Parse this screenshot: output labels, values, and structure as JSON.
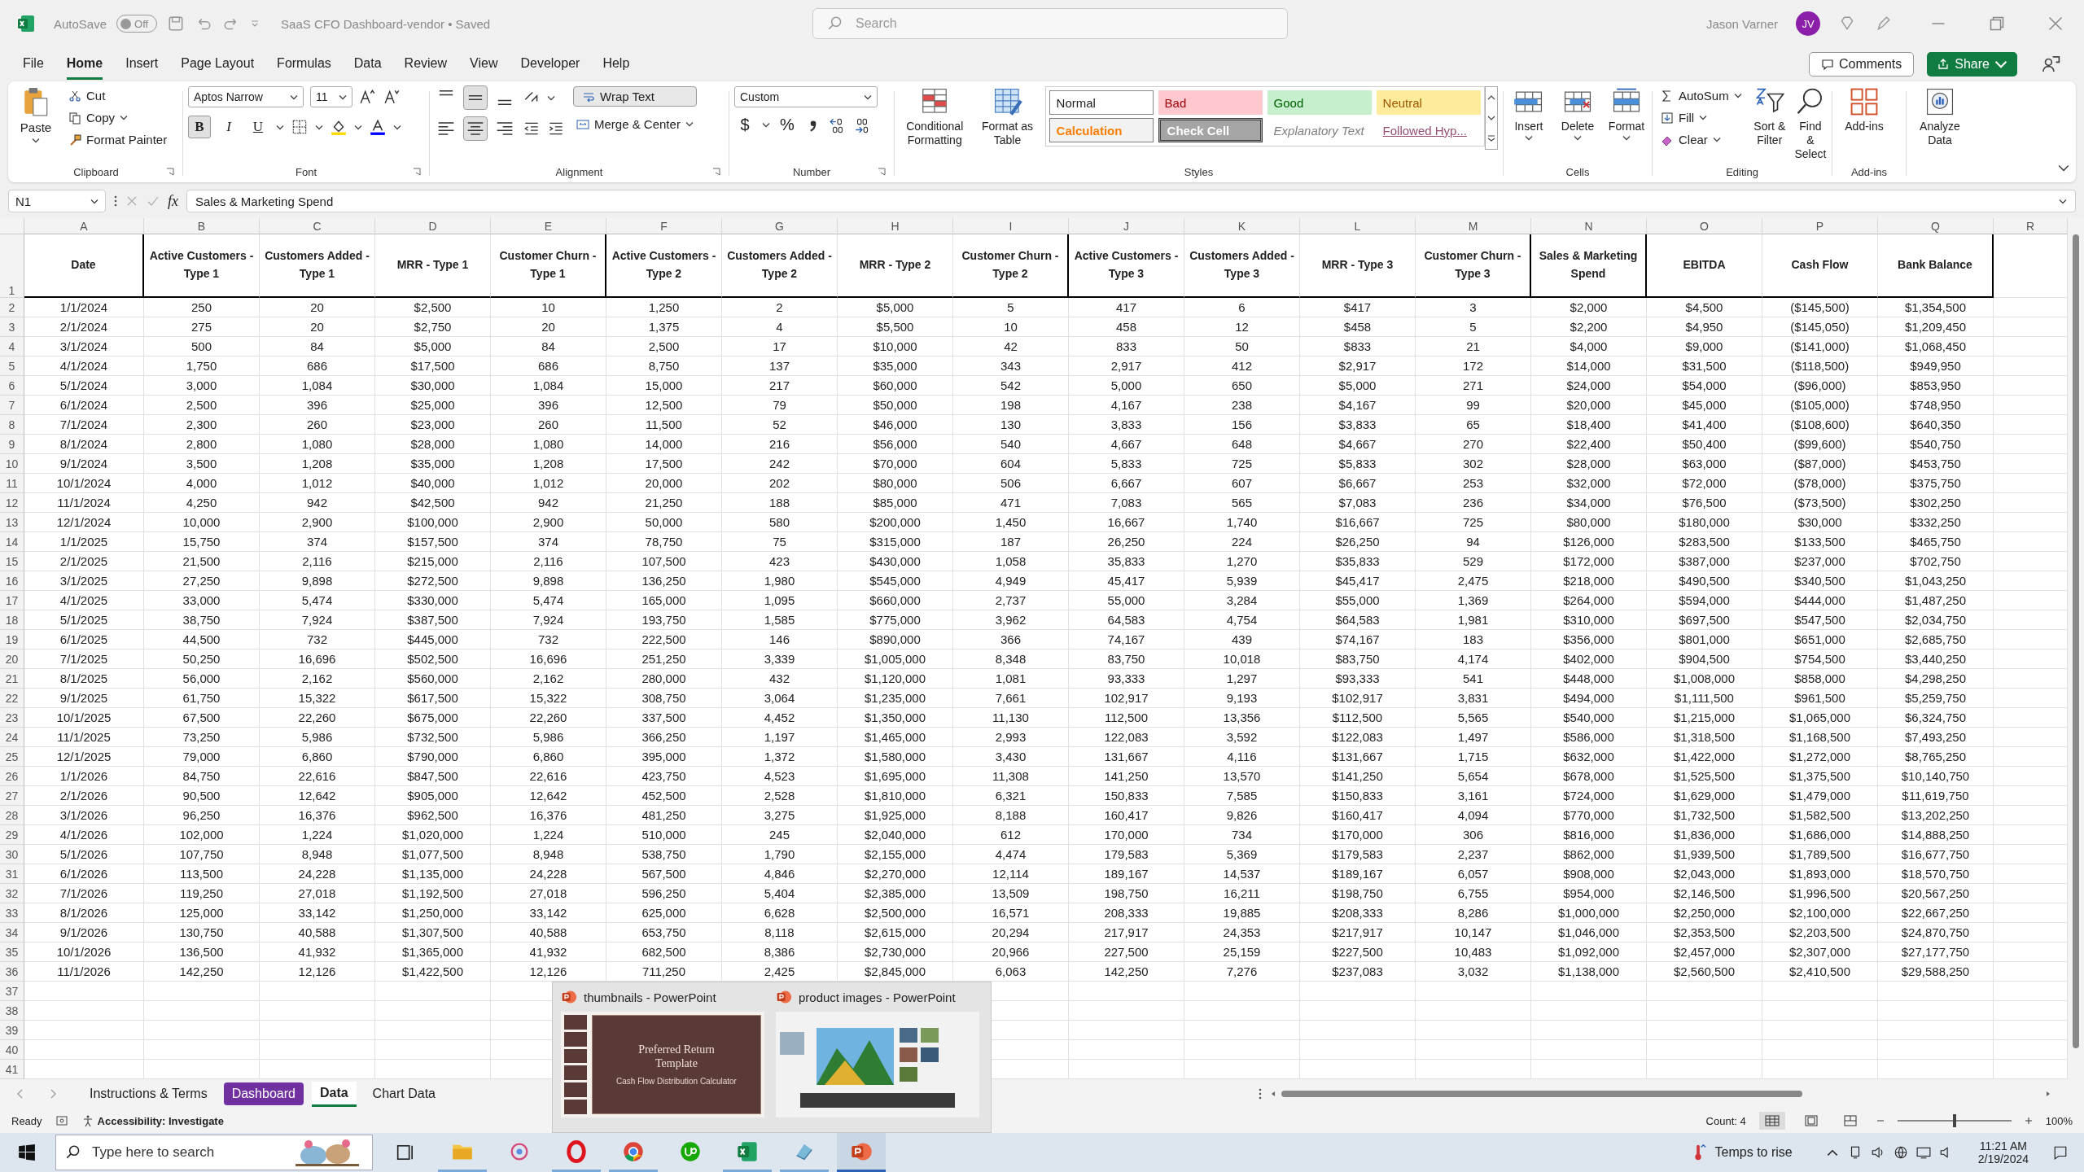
{
  "title_bar": {
    "autosave": "AutoSave",
    "autosave_on": false,
    "toggle_text": "Off",
    "title": "SaaS CFO Dashboard-vendor • Saved",
    "search_placeholder": "Search",
    "user": "Jason Varner",
    "initials": "JV"
  },
  "menu": [
    {
      "label": "File",
      "selected": false
    },
    {
      "label": "Home",
      "selected": true
    },
    {
      "label": "Insert",
      "selected": false
    },
    {
      "label": "Page Layout",
      "selected": false
    },
    {
      "label": "Formulas",
      "selected": false
    },
    {
      "label": "Data",
      "selected": false
    },
    {
      "label": "Review",
      "selected": false
    },
    {
      "label": "View",
      "selected": false
    },
    {
      "label": "Developer",
      "selected": false
    },
    {
      "label": "Help",
      "selected": false
    }
  ],
  "menu_buttons": {
    "comments": "Comments",
    "share": "Share"
  },
  "ribbon": {
    "clipboard": {
      "label": "Clipboard",
      "paste": "Paste",
      "items": [
        "Cut",
        "Copy",
        "Format Painter"
      ]
    },
    "font": {
      "label": "Font",
      "family": "Aptos Narrow",
      "size": "11",
      "styles": [
        {
          "label": "B",
          "on": true
        },
        {
          "label": "I",
          "on": false
        },
        {
          "label": "U",
          "on": false
        }
      ]
    },
    "alignment": {
      "label": "Alignment",
      "wrap": "Wrap Text",
      "merge": "Merge & Center",
      "vertical": [
        {
          "on": false
        },
        {
          "on": true
        },
        {
          "on": false
        }
      ],
      "horizontal": [
        {
          "on": false
        },
        {
          "on": true
        },
        {
          "on": false
        }
      ]
    },
    "number": {
      "label": "Number",
      "format": "Custom",
      "currency": "$",
      "percent": "%"
    },
    "styles": {
      "label": "Styles",
      "buttons": [
        "Conditional Formatting",
        "Format as Table"
      ],
      "cell_styles": [
        {
          "label": "Normal",
          "kind": "normal"
        },
        {
          "label": "Bad",
          "kind": "bad"
        },
        {
          "label": "Good",
          "kind": "good"
        },
        {
          "label": "Neutral",
          "kind": "neutral"
        },
        {
          "label": "Calculation",
          "kind": "calculation"
        },
        {
          "label": "Check Cell",
          "kind": "check"
        },
        {
          "label": "Explanatory Text",
          "kind": "explanatory"
        },
        {
          "label": "Followed Hyp...",
          "kind": "followed"
        }
      ]
    },
    "cells": {
      "label": "Cells",
      "buttons": [
        "Insert",
        "Delete",
        "Format"
      ]
    },
    "editing": {
      "label": "Editing",
      "items": [
        "AutoSum",
        "Fill",
        "Clear"
      ],
      "buttons": [
        "Sort & Filter",
        "Find & Select"
      ]
    },
    "addins": {
      "label": "Add-ins",
      "button": "Add-ins"
    },
    "analyze": {
      "button": "Analyze Data"
    }
  },
  "formula_bar": {
    "name_box": "N1",
    "fx": "fx",
    "formula": "Sales & Marketing Spend"
  },
  "grid": {
    "columns": [
      "A",
      "B",
      "C",
      "D",
      "E",
      "F",
      "G",
      "H",
      "I",
      "J",
      "K",
      "L",
      "M",
      "N",
      "O",
      "P",
      "Q",
      "R"
    ],
    "row_numbers": [
      "1",
      "2",
      "3",
      "4",
      "5",
      "6",
      "7",
      "8",
      "9",
      "10",
      "11",
      "12",
      "13",
      "14",
      "15",
      "16",
      "17",
      "18",
      "19",
      "20",
      "21",
      "22",
      "23",
      "24",
      "25",
      "26",
      "27",
      "28",
      "29",
      "30",
      "31",
      "32",
      "33",
      "34",
      "35",
      "36",
      "37",
      "38",
      "39",
      "40",
      "41"
    ],
    "header": [
      "Date",
      "Active Customers - Type 1",
      "Customers Added - Type 1",
      "MRR - Type 1",
      "Customer Churn - Type 1",
      "Active Customers - Type 2",
      "Customers Added - Type 2",
      "MRR - Type 2",
      "Customer Churn - Type 2",
      "Active Customers - Type 3",
      "Customers Added - Type 3",
      "MRR - Type 3",
      "Customer Churn - Type 3",
      "Sales & Marketing Spend",
      "EBITDA",
      "Cash Flow",
      "Bank Balance"
    ],
    "rows": [
      [
        "1/1/2024",
        "250",
        "20",
        "$2,500",
        "10",
        "1,250",
        "2",
        "$5,000",
        "5",
        "417",
        "6",
        "$417",
        "3",
        "$2,000",
        "$4,500",
        "($145,500)",
        "$1,354,500"
      ],
      [
        "2/1/2024",
        "275",
        "20",
        "$2,750",
        "20",
        "1,375",
        "4",
        "$5,500",
        "10",
        "458",
        "12",
        "$458",
        "5",
        "$2,200",
        "$4,950",
        "($145,050)",
        "$1,209,450"
      ],
      [
        "3/1/2024",
        "500",
        "84",
        "$5,000",
        "84",
        "2,500",
        "17",
        "$10,000",
        "42",
        "833",
        "50",
        "$833",
        "21",
        "$4,000",
        "$9,000",
        "($141,000)",
        "$1,068,450"
      ],
      [
        "4/1/2024",
        "1,750",
        "686",
        "$17,500",
        "686",
        "8,750",
        "137",
        "$35,000",
        "343",
        "2,917",
        "412",
        "$2,917",
        "172",
        "$14,000",
        "$31,500",
        "($118,500)",
        "$949,950"
      ],
      [
        "5/1/2024",
        "3,000",
        "1,084",
        "$30,000",
        "1,084",
        "15,000",
        "217",
        "$60,000",
        "542",
        "5,000",
        "650",
        "$5,000",
        "271",
        "$24,000",
        "$54,000",
        "($96,000)",
        "$853,950"
      ],
      [
        "6/1/2024",
        "2,500",
        "396",
        "$25,000",
        "396",
        "12,500",
        "79",
        "$50,000",
        "198",
        "4,167",
        "238",
        "$4,167",
        "99",
        "$20,000",
        "$45,000",
        "($105,000)",
        "$748,950"
      ],
      [
        "7/1/2024",
        "2,300",
        "260",
        "$23,000",
        "260",
        "11,500",
        "52",
        "$46,000",
        "130",
        "3,833",
        "156",
        "$3,833",
        "65",
        "$18,400",
        "$41,400",
        "($108,600)",
        "$640,350"
      ],
      [
        "8/1/2024",
        "2,800",
        "1,080",
        "$28,000",
        "1,080",
        "14,000",
        "216",
        "$56,000",
        "540",
        "4,667",
        "648",
        "$4,667",
        "270",
        "$22,400",
        "$50,400",
        "($99,600)",
        "$540,750"
      ],
      [
        "9/1/2024",
        "3,500",
        "1,208",
        "$35,000",
        "1,208",
        "17,500",
        "242",
        "$70,000",
        "604",
        "5,833",
        "725",
        "$5,833",
        "302",
        "$28,000",
        "$63,000",
        "($87,000)",
        "$453,750"
      ],
      [
        "10/1/2024",
        "4,000",
        "1,012",
        "$40,000",
        "1,012",
        "20,000",
        "202",
        "$80,000",
        "506",
        "6,667",
        "607",
        "$6,667",
        "253",
        "$32,000",
        "$72,000",
        "($78,000)",
        "$375,750"
      ],
      [
        "11/1/2024",
        "4,250",
        "942",
        "$42,500",
        "942",
        "21,250",
        "188",
        "$85,000",
        "471",
        "7,083",
        "565",
        "$7,083",
        "236",
        "$34,000",
        "$76,500",
        "($73,500)",
        "$302,250"
      ],
      [
        "12/1/2024",
        "10,000",
        "2,900",
        "$100,000",
        "2,900",
        "50,000",
        "580",
        "$200,000",
        "1,450",
        "16,667",
        "1,740",
        "$16,667",
        "725",
        "$80,000",
        "$180,000",
        "$30,000",
        "$332,250"
      ],
      [
        "1/1/2025",
        "15,750",
        "374",
        "$157,500",
        "374",
        "78,750",
        "75",
        "$315,000",
        "187",
        "26,250",
        "224",
        "$26,250",
        "94",
        "$126,000",
        "$283,500",
        "$133,500",
        "$465,750"
      ],
      [
        "2/1/2025",
        "21,500",
        "2,116",
        "$215,000",
        "2,116",
        "107,500",
        "423",
        "$430,000",
        "1,058",
        "35,833",
        "1,270",
        "$35,833",
        "529",
        "$172,000",
        "$387,000",
        "$237,000",
        "$702,750"
      ],
      [
        "3/1/2025",
        "27,250",
        "9,898",
        "$272,500",
        "9,898",
        "136,250",
        "1,980",
        "$545,000",
        "4,949",
        "45,417",
        "5,939",
        "$45,417",
        "2,475",
        "$218,000",
        "$490,500",
        "$340,500",
        "$1,043,250"
      ],
      [
        "4/1/2025",
        "33,000",
        "5,474",
        "$330,000",
        "5,474",
        "165,000",
        "1,095",
        "$660,000",
        "2,737",
        "55,000",
        "3,284",
        "$55,000",
        "1,369",
        "$264,000",
        "$594,000",
        "$444,000",
        "$1,487,250"
      ],
      [
        "5/1/2025",
        "38,750",
        "7,924",
        "$387,500",
        "7,924",
        "193,750",
        "1,585",
        "$775,000",
        "3,962",
        "64,583",
        "4,754",
        "$64,583",
        "1,981",
        "$310,000",
        "$697,500",
        "$547,500",
        "$2,034,750"
      ],
      [
        "6/1/2025",
        "44,500",
        "732",
        "$445,000",
        "732",
        "222,500",
        "146",
        "$890,000",
        "366",
        "74,167",
        "439",
        "$74,167",
        "183",
        "$356,000",
        "$801,000",
        "$651,000",
        "$2,685,750"
      ],
      [
        "7/1/2025",
        "50,250",
        "16,696",
        "$502,500",
        "16,696",
        "251,250",
        "3,339",
        "$1,005,000",
        "8,348",
        "83,750",
        "10,018",
        "$83,750",
        "4,174",
        "$402,000",
        "$904,500",
        "$754,500",
        "$3,440,250"
      ],
      [
        "8/1/2025",
        "56,000",
        "2,162",
        "$560,000",
        "2,162",
        "280,000",
        "432",
        "$1,120,000",
        "1,081",
        "93,333",
        "1,297",
        "$93,333",
        "541",
        "$448,000",
        "$1,008,000",
        "$858,000",
        "$4,298,250"
      ],
      [
        "9/1/2025",
        "61,750",
        "15,322",
        "$617,500",
        "15,322",
        "308,750",
        "3,064",
        "$1,235,000",
        "7,661",
        "102,917",
        "9,193",
        "$102,917",
        "3,831",
        "$494,000",
        "$1,111,500",
        "$961,500",
        "$5,259,750"
      ],
      [
        "10/1/2025",
        "67,500",
        "22,260",
        "$675,000",
        "22,260",
        "337,500",
        "4,452",
        "$1,350,000",
        "11,130",
        "112,500",
        "13,356",
        "$112,500",
        "5,565",
        "$540,000",
        "$1,215,000",
        "$1,065,000",
        "$6,324,750"
      ],
      [
        "11/1/2025",
        "73,250",
        "5,986",
        "$732,500",
        "5,986",
        "366,250",
        "1,197",
        "$1,465,000",
        "2,993",
        "122,083",
        "3,592",
        "$122,083",
        "1,497",
        "$586,000",
        "$1,318,500",
        "$1,168,500",
        "$7,493,250"
      ],
      [
        "12/1/2025",
        "79,000",
        "6,860",
        "$790,000",
        "6,860",
        "395,000",
        "1,372",
        "$1,580,000",
        "3,430",
        "131,667",
        "4,116",
        "$131,667",
        "1,715",
        "$632,000",
        "$1,422,000",
        "$1,272,000",
        "$8,765,250"
      ],
      [
        "1/1/2026",
        "84,750",
        "22,616",
        "$847,500",
        "22,616",
        "423,750",
        "4,523",
        "$1,695,000",
        "11,308",
        "141,250",
        "13,570",
        "$141,250",
        "5,654",
        "$678,000",
        "$1,525,500",
        "$1,375,500",
        "$10,140,750"
      ],
      [
        "2/1/2026",
        "90,500",
        "12,642",
        "$905,000",
        "12,642",
        "452,500",
        "2,528",
        "$1,810,000",
        "6,321",
        "150,833",
        "7,585",
        "$150,833",
        "3,161",
        "$724,000",
        "$1,629,000",
        "$1,479,000",
        "$11,619,750"
      ],
      [
        "3/1/2026",
        "96,250",
        "16,376",
        "$962,500",
        "16,376",
        "481,250",
        "3,275",
        "$1,925,000",
        "8,188",
        "160,417",
        "9,826",
        "$160,417",
        "4,094",
        "$770,000",
        "$1,732,500",
        "$1,582,500",
        "$13,202,250"
      ],
      [
        "4/1/2026",
        "102,000",
        "1,224",
        "$1,020,000",
        "1,224",
        "510,000",
        "245",
        "$2,040,000",
        "612",
        "170,000",
        "734",
        "$170,000",
        "306",
        "$816,000",
        "$1,836,000",
        "$1,686,000",
        "$14,888,250"
      ],
      [
        "5/1/2026",
        "107,750",
        "8,948",
        "$1,077,500",
        "8,948",
        "538,750",
        "1,790",
        "$2,155,000",
        "4,474",
        "179,583",
        "5,369",
        "$179,583",
        "2,237",
        "$862,000",
        "$1,939,500",
        "$1,789,500",
        "$16,677,750"
      ],
      [
        "6/1/2026",
        "113,500",
        "24,228",
        "$1,135,000",
        "24,228",
        "567,500",
        "4,846",
        "$2,270,000",
        "12,114",
        "189,167",
        "14,537",
        "$189,167",
        "6,057",
        "$908,000",
        "$2,043,000",
        "$1,893,000",
        "$18,570,750"
      ],
      [
        "7/1/2026",
        "119,250",
        "27,018",
        "$1,192,500",
        "27,018",
        "596,250",
        "5,404",
        "$2,385,000",
        "13,509",
        "198,750",
        "16,211",
        "$198,750",
        "6,755",
        "$954,000",
        "$2,146,500",
        "$1,996,500",
        "$20,567,250"
      ],
      [
        "8/1/2026",
        "125,000",
        "33,142",
        "$1,250,000",
        "33,142",
        "625,000",
        "6,628",
        "$2,500,000",
        "16,571",
        "208,333",
        "19,885",
        "$208,333",
        "8,286",
        "$1,000,000",
        "$2,250,000",
        "$2,100,000",
        "$22,667,250"
      ],
      [
        "9/1/2026",
        "130,750",
        "40,588",
        "$1,307,500",
        "40,588",
        "653,750",
        "8,118",
        "$2,615,000",
        "20,294",
        "217,917",
        "24,353",
        "$217,917",
        "10,147",
        "$1,046,000",
        "$2,353,500",
        "$2,203,500",
        "$24,870,750"
      ],
      [
        "10/1/2026",
        "136,500",
        "41,932",
        "$1,365,000",
        "41,932",
        "682,500",
        "8,386",
        "$2,730,000",
        "20,966",
        "227,500",
        "25,159",
        "$227,500",
        "10,483",
        "$1,092,000",
        "$2,457,000",
        "$2,307,000",
        "$27,177,750"
      ],
      [
        "11/1/2026",
        "142,250",
        "12,126",
        "$1,422,500",
        "12,126",
        "711,250",
        "2,425",
        "$2,845,000",
        "6,063",
        "142,250",
        "7,276",
        "$237,083",
        "3,032",
        "$1,138,000",
        "$2,560,500",
        "$2,410,500",
        "$29,588,250"
      ]
    ]
  },
  "sheet_tabs": [
    {
      "label": "Instructions & Terms",
      "selected": false
    },
    {
      "label": "Dashboard",
      "selected": false,
      "color": "#7030a0"
    },
    {
      "label": "Data",
      "selected": true
    },
    {
      "label": "Chart Data",
      "selected": false
    }
  ],
  "previews": [
    {
      "title": "thumbnails - PowerPoint",
      "kind": "slides",
      "slide_title": "Preferred Return Template",
      "slide_subtitle": "Cash Flow Distribution Calculator"
    },
    {
      "title": "product images - PowerPoint",
      "kind": "picture"
    }
  ],
  "status_bar": {
    "mode": "Ready",
    "accessibility": "Accessibility: Investigate",
    "count": "Count: 4",
    "zoom": "100%",
    "zoom_slider": {
      "level": 0.5
    }
  },
  "taskbar": {
    "search_placeholder": "Type here to search",
    "weather": "Temps to rise",
    "time": "11:21 AM",
    "date": "2/19/2024"
  }
}
